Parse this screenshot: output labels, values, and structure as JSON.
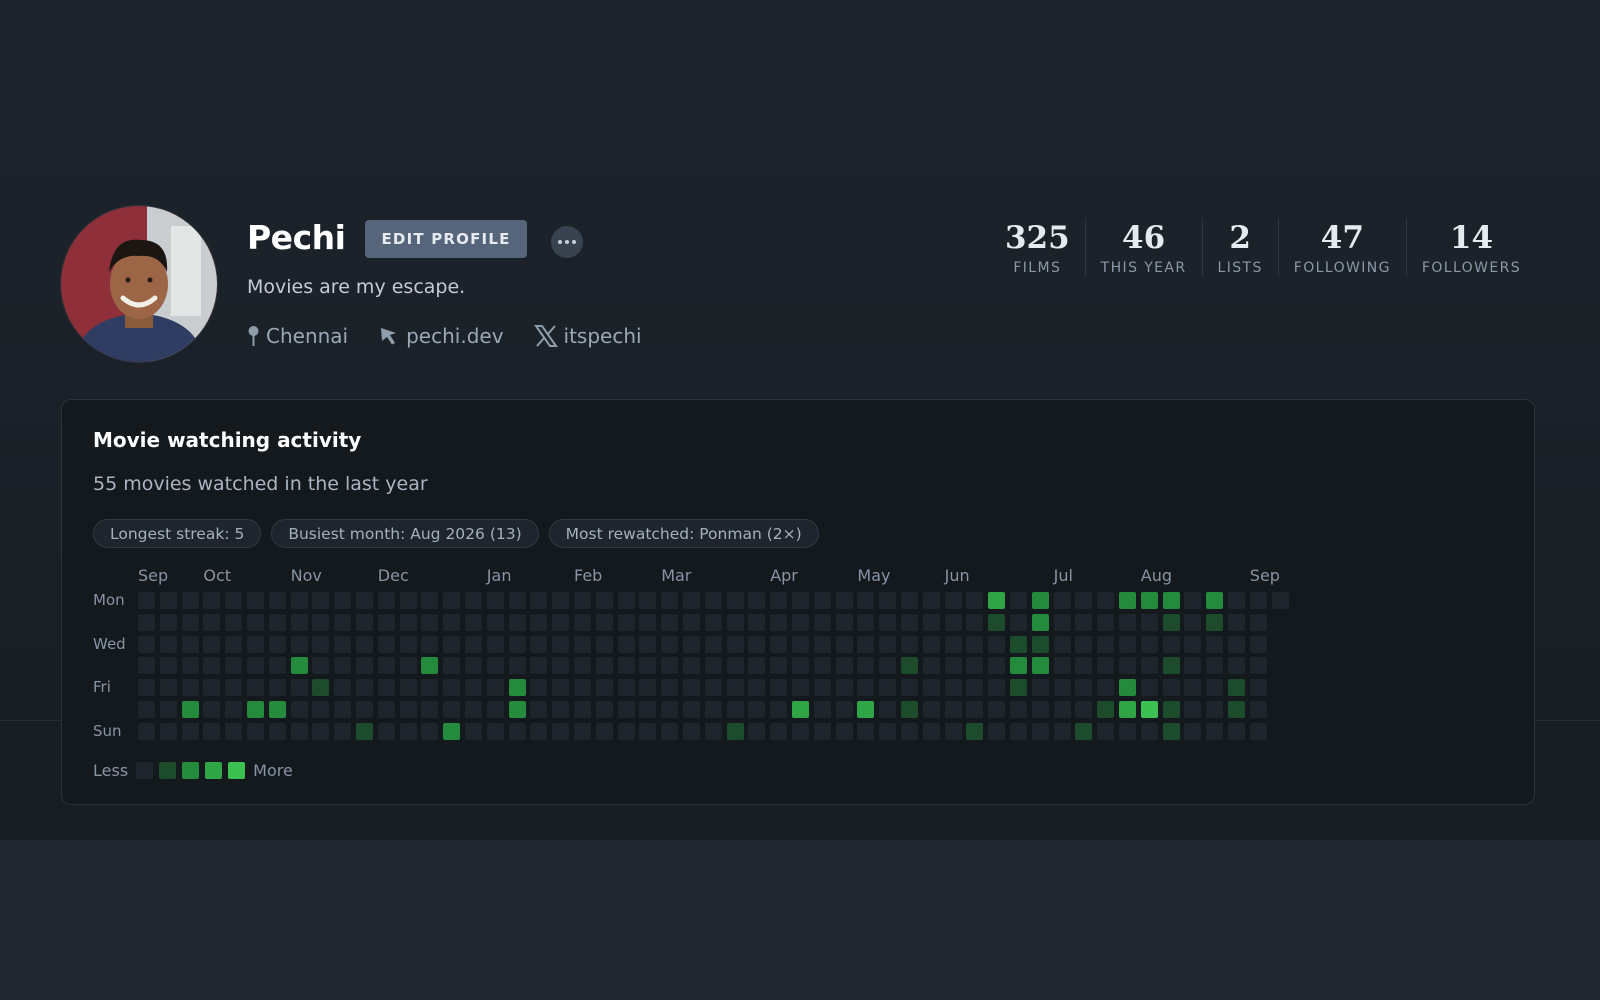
{
  "profile": {
    "name": "Pechi",
    "edit_label": "EDIT PROFILE",
    "bio": "Movies are my escape.",
    "location": "Chennai",
    "website": "pechi.dev",
    "twitter": "itspechi"
  },
  "stats": [
    {
      "value": "325",
      "label": "FILMS"
    },
    {
      "value": "46",
      "label": "THIS YEAR"
    },
    {
      "value": "2",
      "label": "LISTS"
    },
    {
      "value": "47",
      "label": "FOLLOWING"
    },
    {
      "value": "14",
      "label": "FOLLOWERS"
    }
  ],
  "activity": {
    "title": "Movie watching activity",
    "summary": "55 movies watched in the last year",
    "pills": [
      "Longest streak: 5",
      "Busiest month: Aug 2026 (13)",
      "Most rewatched: Ponman (2×)"
    ],
    "months": [
      {
        "label": "Sep",
        "week": 0
      },
      {
        "label": "Oct",
        "week": 3
      },
      {
        "label": "Nov",
        "week": 7
      },
      {
        "label": "Dec",
        "week": 11
      },
      {
        "label": "Jan",
        "week": 16
      },
      {
        "label": "Feb",
        "week": 20
      },
      {
        "label": "Mar",
        "week": 24
      },
      {
        "label": "Apr",
        "week": 29
      },
      {
        "label": "May",
        "week": 33
      },
      {
        "label": "Jun",
        "week": 37
      },
      {
        "label": "Jul",
        "week": 42
      },
      {
        "label": "Aug",
        "week": 46
      },
      {
        "label": "Sep",
        "week": 51
      }
    ],
    "day_labels": [
      {
        "label": "Mon",
        "row": 0
      },
      {
        "label": "Wed",
        "row": 2
      },
      {
        "label": "Fri",
        "row": 4
      },
      {
        "label": "Sun",
        "row": 6
      }
    ],
    "week_count": 52,
    "extra_week_rows": [
      0
    ],
    "legend": {
      "less": "Less",
      "more": "More"
    },
    "level_colors": [
      "#1e252c",
      "#1c4c2c",
      "#248a3c",
      "#2fa547",
      "#3dc052"
    ],
    "active_days": [
      {
        "week": 2,
        "day": 5,
        "level": 2
      },
      {
        "week": 5,
        "day": 5,
        "level": 2
      },
      {
        "week": 6,
        "day": 5,
        "level": 2
      },
      {
        "week": 7,
        "day": 3,
        "level": 2
      },
      {
        "week": 8,
        "day": 4,
        "level": 1
      },
      {
        "week": 10,
        "day": 6,
        "level": 1
      },
      {
        "week": 13,
        "day": 3,
        "level": 2
      },
      {
        "week": 14,
        "day": 6,
        "level": 2
      },
      {
        "week": 17,
        "day": 4,
        "level": 2
      },
      {
        "week": 17,
        "day": 5,
        "level": 2
      },
      {
        "week": 27,
        "day": 6,
        "level": 1
      },
      {
        "week": 30,
        "day": 5,
        "level": 3
      },
      {
        "week": 33,
        "day": 5,
        "level": 3
      },
      {
        "week": 35,
        "day": 3,
        "level": 1
      },
      {
        "week": 35,
        "day": 5,
        "level": 1
      },
      {
        "week": 38,
        "day": 6,
        "level": 1
      },
      {
        "week": 39,
        "day": 0,
        "level": 3
      },
      {
        "week": 39,
        "day": 1,
        "level": 1
      },
      {
        "week": 40,
        "day": 2,
        "level": 1
      },
      {
        "week": 40,
        "day": 3,
        "level": 2
      },
      {
        "week": 40,
        "day": 4,
        "level": 1
      },
      {
        "week": 41,
        "day": 0,
        "level": 2
      },
      {
        "week": 41,
        "day": 1,
        "level": 2
      },
      {
        "week": 41,
        "day": 2,
        "level": 1
      },
      {
        "week": 41,
        "day": 3,
        "level": 2
      },
      {
        "week": 43,
        "day": 6,
        "level": 1
      },
      {
        "week": 44,
        "day": 5,
        "level": 1
      },
      {
        "week": 45,
        "day": 0,
        "level": 2
      },
      {
        "week": 45,
        "day": 4,
        "level": 2
      },
      {
        "week": 45,
        "day": 5,
        "level": 3
      },
      {
        "week": 46,
        "day": 0,
        "level": 2
      },
      {
        "week": 46,
        "day": 5,
        "level": 4
      },
      {
        "week": 47,
        "day": 0,
        "level": 2
      },
      {
        "week": 47,
        "day": 1,
        "level": 1
      },
      {
        "week": 47,
        "day": 3,
        "level": 1
      },
      {
        "week": 47,
        "day": 5,
        "level": 1
      },
      {
        "week": 47,
        "day": 6,
        "level": 1
      },
      {
        "week": 49,
        "day": 0,
        "level": 2
      },
      {
        "week": 49,
        "day": 1,
        "level": 1
      },
      {
        "week": 50,
        "day": 4,
        "level": 1
      },
      {
        "week": 50,
        "day": 5,
        "level": 1
      }
    ]
  }
}
